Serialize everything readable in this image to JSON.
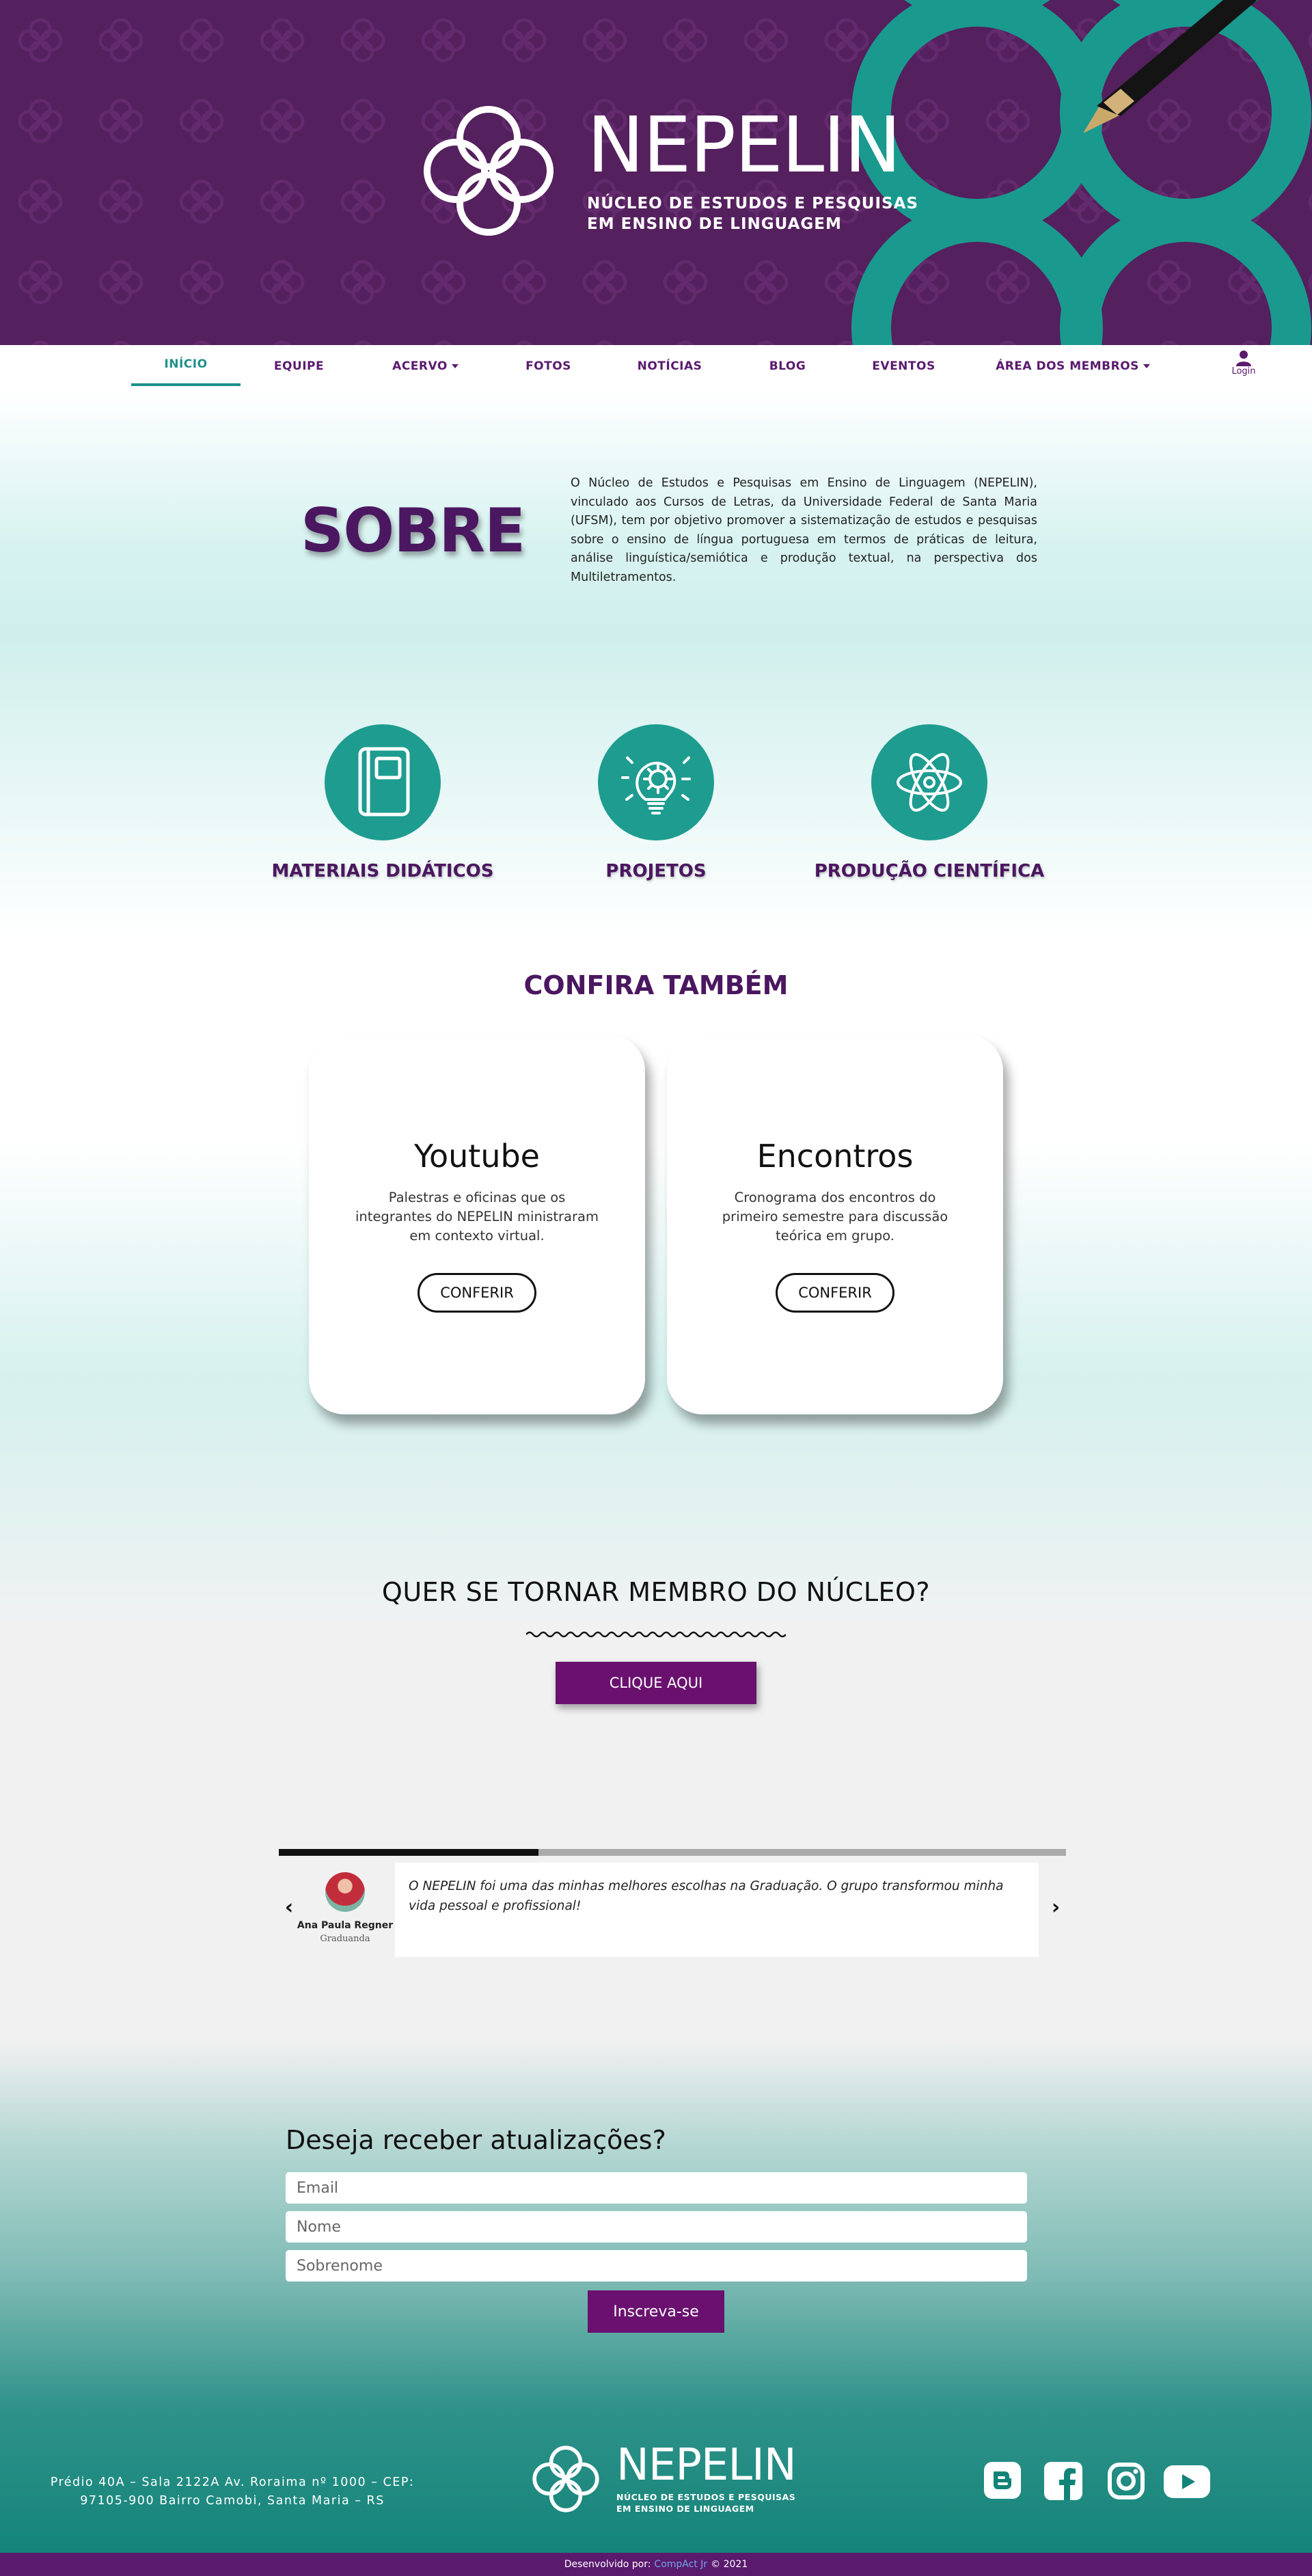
{
  "header": {
    "brand_name": "NEPELIN",
    "brand_sub_line1": "NÚCLEO DE ESTUDOS E PESQUISAS",
    "brand_sub_line2": "EM ENSINO DE LINGUAGEM",
    "colors": {
      "purple": "#54205d",
      "teal": "#1e9c90",
      "accent_purple": "#6a1170"
    }
  },
  "nav": {
    "items": [
      {
        "label": "INÍCIO",
        "active": true
      },
      {
        "label": "EQUIPE"
      },
      {
        "label": "ACERVO",
        "dropdown": true
      },
      {
        "label": "FOTOS"
      },
      {
        "label": "NOTÍCIAS"
      },
      {
        "label": "BLOG"
      },
      {
        "label": "EVENTOS"
      },
      {
        "label": "ÁREA DOS MEMBROS",
        "dropdown": true
      }
    ],
    "login_label": "Login",
    "login_icon": "user-icon"
  },
  "about": {
    "title": "SOBRE",
    "text": "O Núcleo de Estudos e Pesquisas em Ensino de Linguagem (NEPELIN), vinculado aos Cursos de Letras, da Universidade Federal de Santa Maria (UFSM), tem por objetivo promover a sistematização de estudos e pesquisas sobre o ensino de língua portuguesa em termos de práticas de leitura, análise linguística/semiótica e produção textual, na perspectiva dos Multiletramentos."
  },
  "features": [
    {
      "label": "MATERIAIS DIDÁTICOS",
      "icon": "book-icon"
    },
    {
      "label": "PROJETOS",
      "icon": "lightbulb-gear-icon"
    },
    {
      "label": "PRODUÇÃO CIENTÍFICA",
      "icon": "atom-icon"
    }
  ],
  "confira": {
    "title": "CONFIRA TAMBÉM",
    "cards": [
      {
        "title": "Youtube",
        "desc": "Palestras e oficinas que os integrantes do NEPELIN ministraram em contexto virtual.",
        "button": "CONFERIR"
      },
      {
        "title": "Encontros",
        "desc": "Cronograma dos encontros do primeiro semestre para discussão teórica em grupo.",
        "button": "CONFERIR"
      }
    ]
  },
  "membro": {
    "title": "QUER SE TORNAR MEMBRO DO NÚCLEO?",
    "button": "CLIQUE AQUI"
  },
  "testimonial": {
    "progress": 0.33,
    "text": "O NEPELIN foi uma das minhas melhores escolhas na Graduação. O grupo transformou minha vida pessoal e profissional!",
    "name": "Ana Paula Regner",
    "role": "Graduanda",
    "prev_icon": "chevron-left-icon",
    "next_icon": "chevron-right-icon"
  },
  "newsletter": {
    "title": "Deseja receber atualizações?",
    "email_placeholder": "Email",
    "name_placeholder": "Nome",
    "surname_placeholder": "Sobrenome",
    "button": "Inscreva-se"
  },
  "footer": {
    "address_line1": "Prédio 40A – Sala 2122A Av. Roraima nº 1000 – CEP:",
    "address_line2": "97105-900 Bairro Camobi, Santa Maria – RS",
    "brand_name": "NEPELIN",
    "brand_sub_line1": "NÚCLEO DE ESTUDOS E PESQUISAS",
    "brand_sub_line2": "EM ENSINO DE LINGUAGEM",
    "social_icons": [
      "blogger-icon",
      "facebook-icon",
      "instagram-icon",
      "youtube-icon"
    ],
    "dev_prefix": "Desenvolvido por:",
    "dev_name": "CompAct Jr",
    "dev_suffix": "© 2021"
  }
}
